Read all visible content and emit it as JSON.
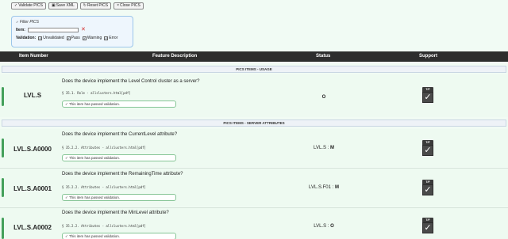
{
  "toolbar": {
    "validate": "Validate PICS",
    "save": "Save XML",
    "reset": "Reset PICS",
    "close": "Close PICS"
  },
  "filter": {
    "title": "Filter PICS",
    "item_label": "Item:",
    "item_value": "",
    "validation_label": "Validation:",
    "options": [
      "Unvalidated",
      "Pass",
      "Warning",
      "Error"
    ]
  },
  "table": {
    "headers": [
      "Item Number",
      "Feature Description",
      "Status",
      "Support"
    ]
  },
  "sections": [
    "PICS ITEMS - USAGE",
    "PICS ITEMS - SERVER ATTRIBUTES"
  ],
  "items": [
    {
      "code": "LVL.S",
      "question": "Does the device implement the Level Control cluster as a server?",
      "ref": "§ 35.1. Role - allclusters.html[pdf]",
      "pass": "✓ This item has passed validation.",
      "status_prefix": "",
      "status_value": "O",
      "tf": "T/F"
    },
    {
      "code": "LVL.S.A0000",
      "question": "Does the device implement the CurrentLevel attribute?",
      "ref": "§ 35.2.2. Attributes - allclusters.html[pdf]",
      "pass": "✓ This item has passed validation.",
      "status_prefix": "LVL.S : ",
      "status_value": "M",
      "tf": "T/F"
    },
    {
      "code": "LVL.S.A0001",
      "question": "Does the device implement the RemainingTime attribute?",
      "ref": "§ 35.2.2. Attributes - allclusters.html[pdf]",
      "pass": "✓ This item has passed validation.",
      "status_prefix": "LVL.S.F01 : ",
      "status_value": "M",
      "tf": "T/F"
    },
    {
      "code": "LVL.S.A0002",
      "question": "Does the device implement the MinLevel attribute?",
      "ref": "§ 35.2.2. Attributes - allclusters.html[pdf]",
      "pass": "✓ This item has passed validation.",
      "status_prefix": "LVL.S : ",
      "status_value": "O",
      "tf": "T/F"
    }
  ]
}
